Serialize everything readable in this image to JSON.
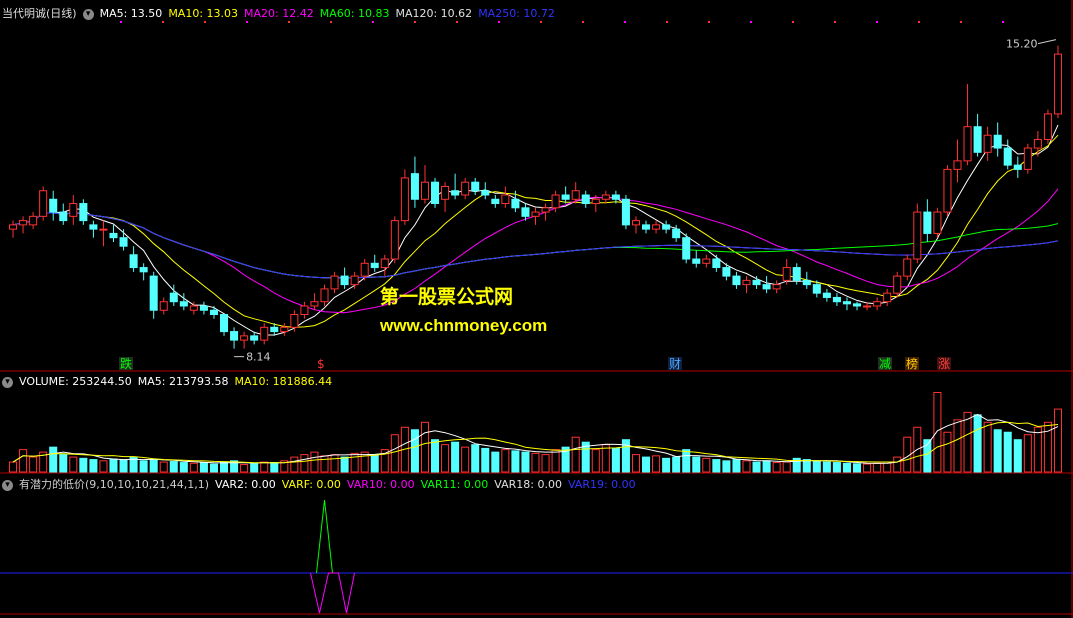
{
  "main": {
    "stock_name": "当代明诚(日线)",
    "ma": [
      {
        "label": "MA5: 13.50",
        "color": "#ffffff"
      },
      {
        "label": "MA10: 13.03",
        "color": "#ffff00"
      },
      {
        "label": "MA20: 12.42",
        "color": "#ff00ff"
      },
      {
        "label": "MA60: 10.83",
        "color": "#00ff00"
      },
      {
        "label": "MA120: 10.62",
        "color": "#e0e0e0"
      },
      {
        "label": "MA250: 10.72",
        "color": "#3333ff"
      }
    ],
    "high_label": "15.20",
    "low_label": "8.14",
    "markers": [
      {
        "text": "跌",
        "color": "#00ff00",
        "bg": "#203020"
      },
      {
        "text": "$",
        "color": "#ff3030",
        "bg": "#000000"
      },
      {
        "text": "财",
        "color": "#4aa8ff",
        "bg": "#102040"
      },
      {
        "text": "减",
        "color": "#00ff00",
        "bg": "#203020"
      },
      {
        "text": "榜",
        "color": "#ffcc00",
        "bg": "#402000"
      },
      {
        "text": "涨",
        "color": "#ff4040",
        "bg": "#401010"
      }
    ]
  },
  "watermark": {
    "line1": "第一股票公式网",
    "line2": "www.chnmoney.com"
  },
  "volume": {
    "label": "VOLUME: 253244.50",
    "ma5": "MA5: 213793.58",
    "ma10": "MA10: 181886.44"
  },
  "indicator": {
    "name": "有潜力的低价(9,10,10,10,21,44,1,1)",
    "vars": [
      {
        "label": "VAR2: 0.00",
        "color": "#ffffff"
      },
      {
        "label": "VARF: 0.00",
        "color": "#ffff00"
      },
      {
        "label": "VAR10: 0.00",
        "color": "#ff00ff"
      },
      {
        "label": "VAR11: 0.00",
        "color": "#00ff00"
      },
      {
        "label": "VAR18: 0.00",
        "color": "#e0e0e0"
      },
      {
        "label": "VAR19: 0.00",
        "color": "#3333ff"
      }
    ]
  },
  "chart_data": {
    "type": "candlestick",
    "yrange": [
      7.6,
      15.8
    ],
    "candles": [
      [
        10.9,
        11.1,
        10.7,
        11.0
      ],
      [
        11.0,
        11.2,
        10.8,
        11.1
      ],
      [
        11.0,
        11.3,
        10.9,
        11.2
      ],
      [
        11.2,
        11.9,
        11.1,
        11.8
      ],
      [
        11.6,
        11.8,
        11.1,
        11.3
      ],
      [
        11.3,
        11.5,
        11.0,
        11.1
      ],
      [
        11.2,
        11.7,
        11.0,
        11.5
      ],
      [
        11.5,
        11.6,
        11.0,
        11.1
      ],
      [
        11.0,
        11.1,
        10.7,
        10.9
      ],
      [
        10.9,
        11.1,
        10.5,
        10.9
      ],
      [
        10.8,
        11.0,
        10.6,
        10.7
      ],
      [
        10.7,
        10.9,
        10.4,
        10.5
      ],
      [
        10.3,
        10.5,
        9.9,
        10.0
      ],
      [
        10.0,
        10.1,
        9.7,
        9.9
      ],
      [
        9.8,
        9.9,
        8.8,
        9.0
      ],
      [
        9.0,
        9.3,
        8.9,
        9.2
      ],
      [
        9.4,
        9.6,
        9.1,
        9.2
      ],
      [
        9.2,
        9.4,
        9.0,
        9.1
      ],
      [
        9.0,
        9.2,
        8.9,
        9.1
      ],
      [
        9.1,
        9.2,
        8.9,
        9.0
      ],
      [
        9.0,
        9.1,
        8.8,
        8.9
      ],
      [
        8.9,
        8.9,
        8.4,
        8.5
      ],
      [
        8.5,
        8.6,
        8.1,
        8.3
      ],
      [
        8.3,
        8.5,
        8.1,
        8.4
      ],
      [
        8.4,
        8.5,
        8.2,
        8.3
      ],
      [
        8.3,
        8.7,
        8.2,
        8.6
      ],
      [
        8.6,
        8.7,
        8.4,
        8.5
      ],
      [
        8.5,
        8.7,
        8.4,
        8.6
      ],
      [
        8.6,
        9.0,
        8.5,
        8.9
      ],
      [
        8.9,
        9.2,
        8.8,
        9.1
      ],
      [
        9.1,
        9.4,
        9.0,
        9.2
      ],
      [
        9.2,
        9.6,
        9.1,
        9.5
      ],
      [
        9.5,
        9.9,
        9.4,
        9.8
      ],
      [
        9.8,
        10.0,
        9.5,
        9.6
      ],
      [
        9.6,
        9.9,
        9.5,
        9.8
      ],
      [
        9.8,
        10.2,
        9.7,
        10.1
      ],
      [
        10.1,
        10.3,
        9.9,
        10.0
      ],
      [
        10.0,
        10.3,
        9.8,
        10.2
      ],
      [
        10.2,
        11.2,
        10.1,
        11.1
      ],
      [
        11.1,
        12.3,
        11.0,
        12.1
      ],
      [
        12.2,
        12.6,
        11.4,
        11.6
      ],
      [
        11.6,
        12.4,
        11.5,
        12.0
      ],
      [
        12.0,
        12.1,
        11.4,
        11.5
      ],
      [
        11.6,
        12.0,
        11.3,
        11.9
      ],
      [
        11.8,
        12.2,
        11.6,
        11.7
      ],
      [
        11.7,
        12.1,
        11.6,
        12.0
      ],
      [
        12.0,
        12.1,
        11.7,
        11.8
      ],
      [
        11.8,
        12.0,
        11.6,
        11.7
      ],
      [
        11.6,
        11.7,
        11.4,
        11.5
      ],
      [
        11.5,
        11.9,
        11.4,
        11.7
      ],
      [
        11.6,
        11.8,
        11.3,
        11.4
      ],
      [
        11.4,
        11.5,
        11.1,
        11.2
      ],
      [
        11.2,
        11.4,
        11.0,
        11.3
      ],
      [
        11.3,
        11.5,
        11.1,
        11.4
      ],
      [
        11.4,
        11.8,
        11.3,
        11.7
      ],
      [
        11.7,
        11.9,
        11.5,
        11.6
      ],
      [
        11.6,
        12.0,
        11.5,
        11.8
      ],
      [
        11.7,
        11.8,
        11.4,
        11.5
      ],
      [
        11.5,
        11.7,
        11.3,
        11.6
      ],
      [
        11.6,
        11.8,
        11.5,
        11.7
      ],
      [
        11.7,
        11.8,
        11.5,
        11.6
      ],
      [
        11.6,
        11.7,
        10.9,
        11.0
      ],
      [
        11.0,
        11.2,
        10.8,
        11.1
      ],
      [
        11.0,
        11.1,
        10.8,
        10.9
      ],
      [
        10.9,
        11.1,
        10.8,
        11.0
      ],
      [
        11.0,
        11.1,
        10.8,
        10.9
      ],
      [
        10.9,
        11.0,
        10.6,
        10.7
      ],
      [
        10.7,
        10.8,
        10.1,
        10.2
      ],
      [
        10.2,
        10.4,
        10.0,
        10.1
      ],
      [
        10.1,
        10.3,
        10.0,
        10.2
      ],
      [
        10.2,
        10.3,
        9.9,
        10.0
      ],
      [
        10.0,
        10.1,
        9.7,
        9.8
      ],
      [
        9.8,
        9.9,
        9.5,
        9.6
      ],
      [
        9.6,
        9.8,
        9.4,
        9.7
      ],
      [
        9.7,
        9.8,
        9.5,
        9.6
      ],
      [
        9.6,
        9.8,
        9.4,
        9.5
      ],
      [
        9.5,
        9.7,
        9.4,
        9.6
      ],
      [
        9.7,
        10.2,
        9.6,
        10.0
      ],
      [
        10.0,
        10.1,
        9.6,
        9.7
      ],
      [
        9.7,
        9.9,
        9.5,
        9.6
      ],
      [
        9.6,
        9.7,
        9.3,
        9.4
      ],
      [
        9.4,
        9.5,
        9.2,
        9.3
      ],
      [
        9.3,
        9.4,
        9.1,
        9.2
      ],
      [
        9.2,
        9.3,
        9.0,
        9.15
      ],
      [
        9.15,
        9.2,
        9.0,
        9.1
      ],
      [
        9.1,
        9.2,
        9.0,
        9.1
      ],
      [
        9.1,
        9.3,
        9.0,
        9.2
      ],
      [
        9.2,
        9.5,
        9.1,
        9.4
      ],
      [
        9.4,
        9.9,
        9.3,
        9.8
      ],
      [
        9.8,
        10.3,
        9.7,
        10.2
      ],
      [
        10.2,
        11.5,
        10.1,
        11.3
      ],
      [
        11.3,
        11.6,
        10.6,
        10.8
      ],
      [
        10.8,
        11.4,
        10.7,
        11.3
      ],
      [
        11.3,
        12.4,
        11.2,
        12.3
      ],
      [
        12.3,
        13.0,
        12.0,
        12.5
      ],
      [
        12.5,
        14.3,
        12.4,
        13.3
      ],
      [
        13.3,
        13.6,
        12.6,
        12.7
      ],
      [
        12.7,
        13.3,
        12.5,
        13.1
      ],
      [
        13.1,
        13.4,
        12.6,
        12.8
      ],
      [
        12.8,
        13.0,
        12.3,
        12.4
      ],
      [
        12.4,
        12.6,
        12.1,
        12.3
      ],
      [
        12.3,
        12.9,
        12.2,
        12.8
      ],
      [
        12.8,
        13.2,
        12.6,
        13.0
      ],
      [
        13.0,
        13.7,
        12.9,
        13.6
      ],
      [
        13.6,
        15.2,
        13.5,
        15.0
      ]
    ],
    "volume_yrange": [
      0,
      330000
    ],
    "volume": [
      40000,
      90000,
      60000,
      80000,
      100000,
      70000,
      60000,
      55000,
      50000,
      45000,
      52000,
      48000,
      60000,
      45000,
      50000,
      40000,
      42000,
      38000,
      35000,
      38000,
      32000,
      40000,
      45000,
      30000,
      35000,
      40000,
      38000,
      45000,
      60000,
      70000,
      80000,
      65000,
      70000,
      60000,
      75000,
      80000,
      70000,
      90000,
      150000,
      180000,
      170000,
      200000,
      130000,
      110000,
      120000,
      100000,
      110000,
      95000,
      80000,
      90000,
      85000,
      80000,
      75000,
      70000,
      90000,
      100000,
      140000,
      120000,
      90000,
      110000,
      95000,
      130000,
      70000,
      60000,
      65000,
      55000,
      60000,
      90000,
      60000,
      55000,
      50000,
      45000,
      50000,
      45000,
      40000,
      45000,
      38000,
      40000,
      55000,
      50000,
      45000,
      40000,
      38000,
      35000,
      33000,
      32000,
      35000,
      40000,
      60000,
      140000,
      180000,
      130000,
      320000,
      160000,
      210000,
      240000,
      230000,
      200000,
      170000,
      160000,
      130000,
      150000,
      180000,
      200000,
      253244
    ],
    "indicator_spike": {
      "index": 31,
      "yrange": [
        -1,
        2
      ],
      "value": 1.5
    }
  }
}
